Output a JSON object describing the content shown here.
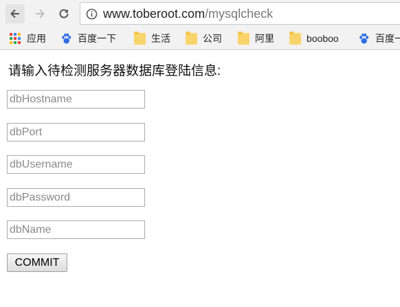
{
  "browser": {
    "url_host": "www.toberoot.com",
    "url_path": "/mysqlcheck",
    "bookmarks": [
      {
        "label": "应用",
        "icon": "apps-grid-icon"
      },
      {
        "label": "百度一下",
        "icon": "baidu-paw-icon"
      },
      {
        "label": "生活",
        "icon": "folder-icon"
      },
      {
        "label": "公司",
        "icon": "folder-icon"
      },
      {
        "label": "阿里",
        "icon": "folder-icon"
      },
      {
        "label": "booboo",
        "icon": "folder-icon"
      },
      {
        "label": "百度一",
        "icon": "baidu-paw-icon"
      }
    ]
  },
  "form": {
    "heading": "请输入待检测服务器数据库登陆信息:",
    "fields": [
      {
        "placeholder": "dbHostname",
        "value": ""
      },
      {
        "placeholder": "dbPort",
        "value": ""
      },
      {
        "placeholder": "dbUsername",
        "value": ""
      },
      {
        "placeholder": "dbPassword",
        "value": ""
      },
      {
        "placeholder": "dbName",
        "value": ""
      }
    ],
    "submit_label": "COMMIT"
  },
  "colors": {
    "toolbar_bg": "#f2f2f2",
    "folder": "#f9d46a",
    "baidu_blue": "#2f6fe3"
  }
}
